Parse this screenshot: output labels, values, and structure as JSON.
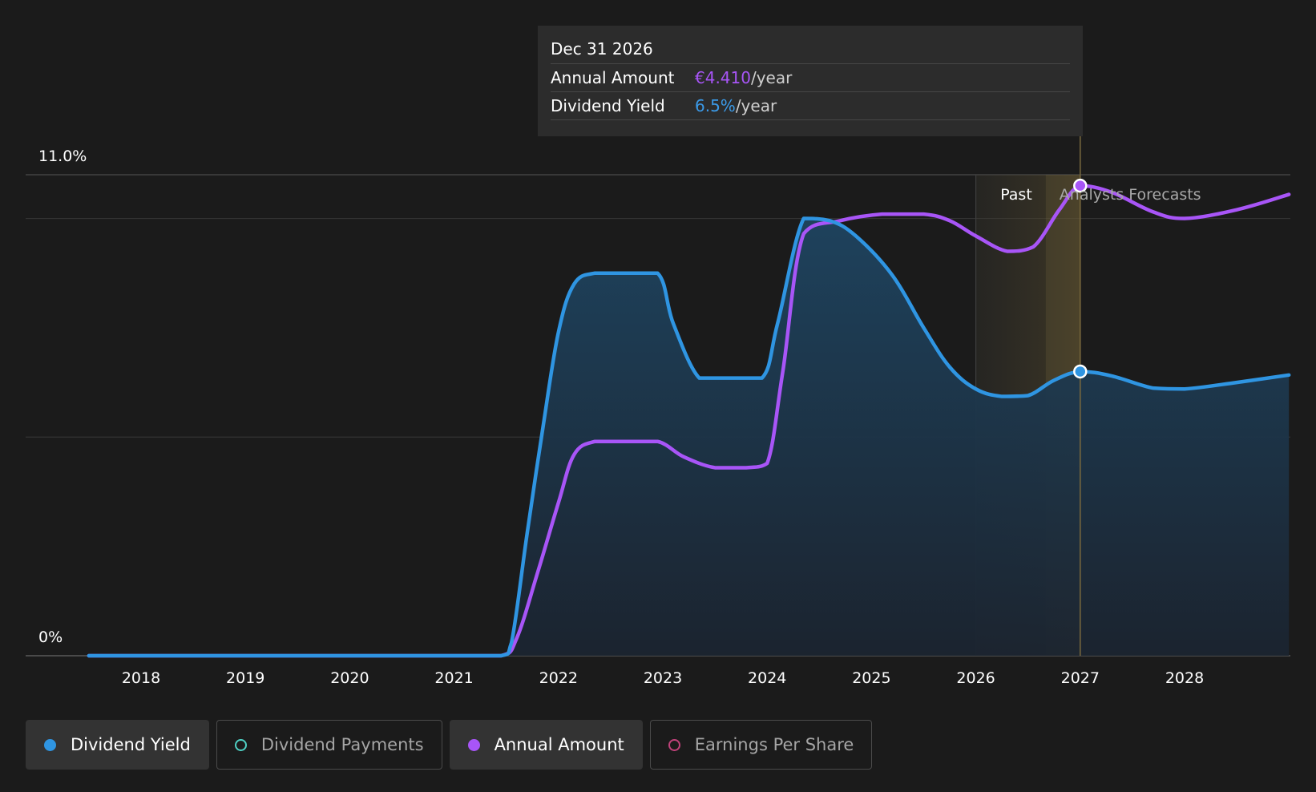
{
  "tooltip": {
    "date": "Dec 31 2026",
    "rows": [
      {
        "key": "Annual Amount",
        "value": "€4.410",
        "unit": "/year",
        "color": "#a855f7"
      },
      {
        "key": "Dividend Yield",
        "value": "6.5%",
        "unit": "/year",
        "color": "#3b9ae8"
      }
    ]
  },
  "regions": {
    "past": "Past",
    "forecast": "Analysts Forecasts"
  },
  "legend": [
    {
      "label": "Dividend Yield",
      "color": "#2f95e2",
      "active": true,
      "filled": true
    },
    {
      "label": "Dividend Payments",
      "color": "#4fd1c5",
      "active": false,
      "filled": false
    },
    {
      "label": "Annual Amount",
      "color": "#a855f7",
      "active": true,
      "filled": true
    },
    {
      "label": "Earnings Per Share",
      "color": "#c0427a",
      "active": false,
      "filled": false
    }
  ],
  "chart_data": {
    "type": "area",
    "x_range": [
      2017.5,
      2029.0
    ],
    "ylim": [
      0,
      11.0
    ],
    "y_ticks": [
      "0%",
      "11.0%"
    ],
    "x_ticks": [
      "2018",
      "2019",
      "2020",
      "2021",
      "2022",
      "2023",
      "2024",
      "2025",
      "2026",
      "2027",
      "2028"
    ],
    "gridlines": [
      0,
      5.0,
      10.0,
      11.0
    ],
    "past_end": 2026.0,
    "forecast_start": 2026.67,
    "cursor_x": 2027.0,
    "series": [
      {
        "name": "Dividend Yield",
        "color": "#2f95e2",
        "points": [
          [
            2017.5,
            0
          ],
          [
            2018,
            0
          ],
          [
            2019,
            0
          ],
          [
            2020,
            0
          ],
          [
            2021,
            0
          ],
          [
            2021.45,
            0
          ],
          [
            2021.55,
            0.3
          ],
          [
            2021.7,
            2.8
          ],
          [
            2021.85,
            5.2
          ],
          [
            2022,
            7.4
          ],
          [
            2022.15,
            8.5
          ],
          [
            2022.35,
            8.75
          ],
          [
            2022.6,
            8.75
          ],
          [
            2022.95,
            8.75
          ],
          [
            2023.1,
            7.6
          ],
          [
            2023.35,
            6.35
          ],
          [
            2023.6,
            6.35
          ],
          [
            2023.95,
            6.35
          ],
          [
            2024.1,
            7.6
          ],
          [
            2024.35,
            10.0
          ],
          [
            2024.6,
            9.95
          ],
          [
            2024.85,
            9.6
          ],
          [
            2025.2,
            8.7
          ],
          [
            2025.5,
            7.5
          ],
          [
            2025.75,
            6.6
          ],
          [
            2026,
            6.1
          ],
          [
            2026.25,
            5.93
          ],
          [
            2026.5,
            5.95
          ],
          [
            2026.75,
            6.3
          ],
          [
            2027,
            6.5
          ],
          [
            2027.3,
            6.4
          ],
          [
            2027.7,
            6.12
          ],
          [
            2028,
            6.1
          ],
          [
            2028.5,
            6.25
          ],
          [
            2029,
            6.42
          ]
        ]
      },
      {
        "name": "Annual Amount",
        "color": "#a855f7",
        "points": [
          [
            2017.5,
            0
          ],
          [
            2018,
            0
          ],
          [
            2019,
            0
          ],
          [
            2020,
            0
          ],
          [
            2021,
            0
          ],
          [
            2021.45,
            0
          ],
          [
            2021.6,
            0.4
          ],
          [
            2021.8,
            1.9
          ],
          [
            2022,
            3.5
          ],
          [
            2022.15,
            4.6
          ],
          [
            2022.35,
            4.9
          ],
          [
            2022.6,
            4.9
          ],
          [
            2022.95,
            4.9
          ],
          [
            2023.2,
            4.55
          ],
          [
            2023.5,
            4.3
          ],
          [
            2023.8,
            4.3
          ],
          [
            2024,
            4.4
          ],
          [
            2024.15,
            6.5
          ],
          [
            2024.35,
            9.65
          ],
          [
            2024.7,
            9.95
          ],
          [
            2025.1,
            10.1
          ],
          [
            2025.5,
            10.1
          ],
          [
            2025.75,
            9.95
          ],
          [
            2026,
            9.6
          ],
          [
            2026.3,
            9.25
          ],
          [
            2026.55,
            9.35
          ],
          [
            2026.8,
            10.2
          ],
          [
            2027,
            10.75
          ],
          [
            2027.3,
            10.6
          ],
          [
            2027.7,
            10.15
          ],
          [
            2028,
            10.0
          ],
          [
            2028.5,
            10.2
          ],
          [
            2029,
            10.55
          ]
        ]
      }
    ]
  }
}
